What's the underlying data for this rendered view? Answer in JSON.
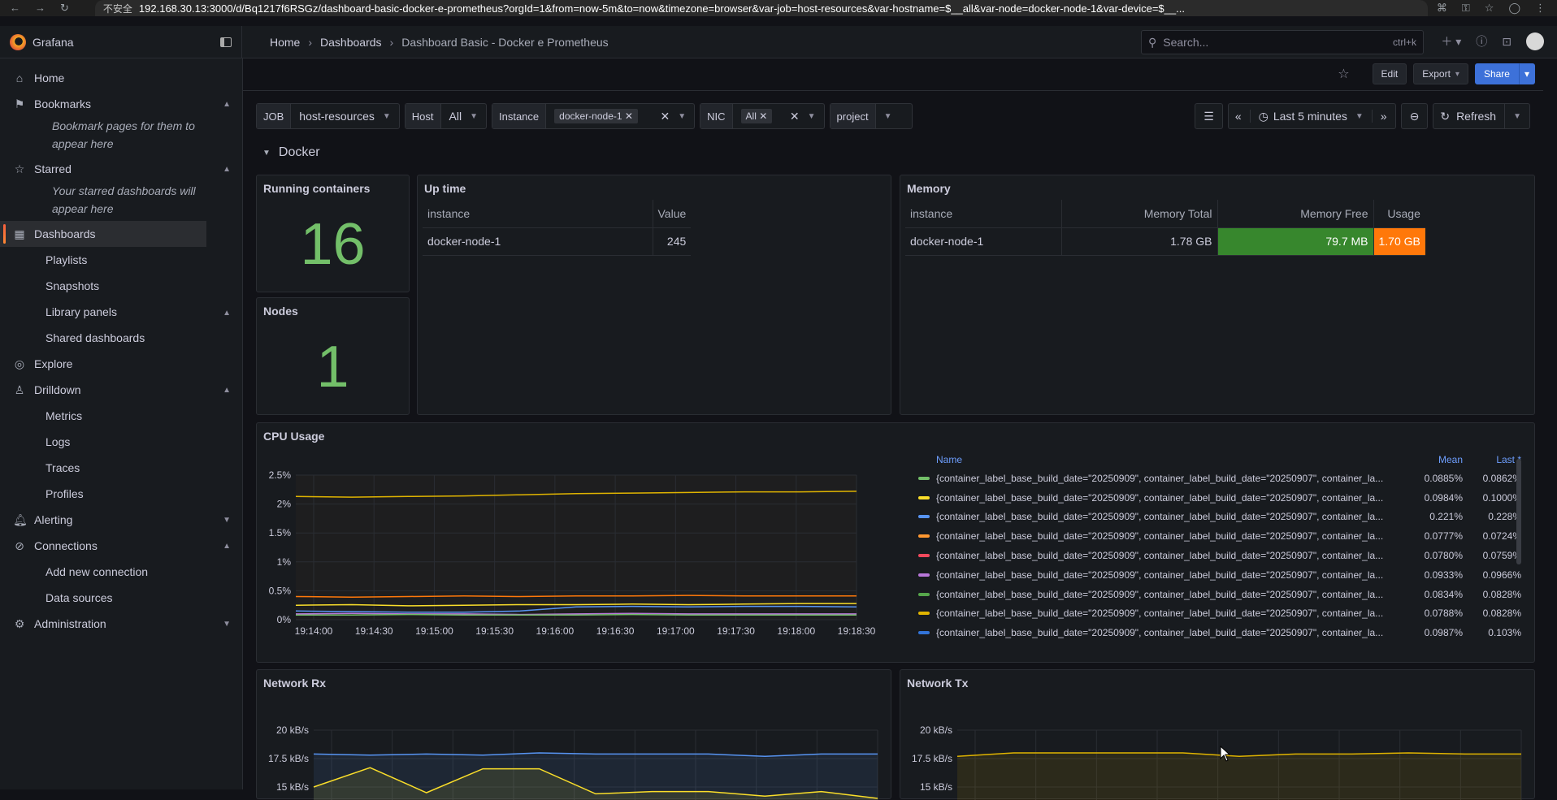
{
  "browser": {
    "insecure": "不安全",
    "url": "192.168.30.13:3000/d/Bq1217f6RSGz/dashboard-basic-docker-e-prometheus?orgId=1&from=now-5m&to=now&timezone=browser&var-job=host-resources&var-hostname=$__all&var-node=docker-node-1&var-device=$__..."
  },
  "app": {
    "name": "Grafana"
  },
  "breadcrumb": [
    "Home",
    "Dashboards",
    "Dashboard Basic - Docker e Prometheus"
  ],
  "search": {
    "placeholder": "Search...",
    "shortcut": "ctrl+k"
  },
  "toolbar": {
    "edit": "Edit",
    "export": "Export",
    "share": "Share"
  },
  "sidebar": {
    "home": "Home",
    "bookmarks": "Bookmarks",
    "bookmarks_hint": "Bookmark pages for them to appear here",
    "starred": "Starred",
    "starred_hint": "Your starred dashboards will appear here",
    "dashboards": "Dashboards",
    "dash_sub": [
      "Playlists",
      "Snapshots",
      "Library panels",
      "Shared dashboards"
    ],
    "explore": "Explore",
    "drilldown": "Drilldown",
    "drill_sub": [
      "Metrics",
      "Logs",
      "Traces",
      "Profiles"
    ],
    "alerting": "Alerting",
    "connections": "Connections",
    "conn_sub": [
      "Add new connection",
      "Data sources"
    ],
    "administration": "Administration"
  },
  "variables": {
    "job_label": "JOB",
    "job_value": "host-resources",
    "host_label": "Host",
    "host_value": "All",
    "instance_label": "Instance",
    "instance_value": "docker-node-1",
    "nic_label": "NIC",
    "nic_value": "All",
    "project_label": "project"
  },
  "time": {
    "range": "Last 5 minutes",
    "refresh": "Refresh"
  },
  "row": {
    "title": "Docker"
  },
  "panels": {
    "running": {
      "title": "Running containers",
      "value": "16"
    },
    "nodes": {
      "title": "Nodes",
      "value": "1"
    },
    "uptime": {
      "title": "Up time",
      "col1": "instance",
      "col2": "Value",
      "instance": "docker-node-1",
      "value": "245"
    },
    "memory": {
      "title": "Memory",
      "col1": "instance",
      "col2": "Memory Total",
      "col3": "Memory Free",
      "col4": "Usage",
      "instance": "docker-node-1",
      "total": "1.78 GB",
      "free": "79.7 MB",
      "usage": "1.70 GB",
      "free_color": "#37872d",
      "usage_color": "#ff780a"
    },
    "cpu": {
      "title": "CPU Usage",
      "legend_name": "Name",
      "legend_mean": "Mean",
      "legend_last": "Last *"
    },
    "netrx": {
      "title": "Network Rx"
    },
    "nettx": {
      "title": "Network Tx"
    }
  },
  "cpu_legend": [
    {
      "name": "{container_label_base_build_date=\"20250909\", container_label_build_date=\"20250907\", container_la...",
      "mean": "0.0885%",
      "last": "0.0862%",
      "color": "#73bf69"
    },
    {
      "name": "{container_label_base_build_date=\"20250909\", container_label_build_date=\"20250907\", container_la...",
      "mean": "0.0984%",
      "last": "0.1000%",
      "color": "#fade2a"
    },
    {
      "name": "{container_label_base_build_date=\"20250909\", container_label_build_date=\"20250907\", container_la...",
      "mean": "0.221%",
      "last": "0.228%",
      "color": "#5794f2"
    },
    {
      "name": "{container_label_base_build_date=\"20250909\", container_label_build_date=\"20250907\", container_la...",
      "mean": "0.0777%",
      "last": "0.0724%",
      "color": "#ff9830"
    },
    {
      "name": "{container_label_base_build_date=\"20250909\", container_label_build_date=\"20250907\", container_la...",
      "mean": "0.0780%",
      "last": "0.0759%",
      "color": "#f2495c"
    },
    {
      "name": "{container_label_base_build_date=\"20250909\", container_label_build_date=\"20250907\", container_la...",
      "mean": "0.0933%",
      "last": "0.0966%",
      "color": "#b877d9"
    },
    {
      "name": "{container_label_base_build_date=\"20250909\", container_label_build_date=\"20250907\", container_la...",
      "mean": "0.0834%",
      "last": "0.0828%",
      "color": "#56a64b"
    },
    {
      "name": "{container_label_base_build_date=\"20250909\", container_label_build_date=\"20250907\", container_la...",
      "mean": "0.0788%",
      "last": "0.0828%",
      "color": "#e0b400"
    },
    {
      "name": "{container_label_base_build_date=\"20250909\", container_label_build_date=\"20250907\", container_la...",
      "mean": "0.0987%",
      "last": "0.103%",
      "color": "#3274d9"
    }
  ],
  "chart_data": [
    {
      "type": "line",
      "title": "CPU Usage",
      "y_ticks": [
        "2.5%",
        "2%",
        "1.5%",
        "1%",
        "0.5%",
        "0%"
      ],
      "x_ticks": [
        "19:14:00",
        "19:14:30",
        "19:15:00",
        "19:15:30",
        "19:16:00",
        "19:16:30",
        "19:17:00",
        "19:17:30",
        "19:18:00",
        "19:18:30"
      ],
      "ylim": [
        0,
        2.5
      ],
      "series": [
        {
          "color": "#e0b400",
          "values": [
            2.13,
            2.12,
            2.13,
            2.14,
            2.16,
            2.18,
            2.19,
            2.2,
            2.21,
            2.21,
            2.22
          ]
        },
        {
          "color": "#ff780a",
          "values": [
            0.4,
            0.39,
            0.4,
            0.41,
            0.4,
            0.41,
            0.41,
            0.42,
            0.41,
            0.41,
            0.41
          ]
        },
        {
          "color": "#fade2a",
          "values": [
            0.25,
            0.26,
            0.24,
            0.25,
            0.26,
            0.26,
            0.27,
            0.26,
            0.27,
            0.28,
            0.28
          ]
        },
        {
          "color": "#5794f2",
          "values": [
            0.15,
            0.14,
            0.13,
            0.13,
            0.15,
            0.22,
            0.23,
            0.22,
            0.23,
            0.23,
            0.22
          ]
        },
        {
          "color": "#b877d9",
          "values": [
            0.1,
            0.11,
            0.1,
            0.1,
            0.09,
            0.1,
            0.11,
            0.1,
            0.1,
            0.1,
            0.1
          ]
        },
        {
          "color": "#73bf69",
          "values": [
            0.08,
            0.08,
            0.09,
            0.08,
            0.08,
            0.08,
            0.09,
            0.08,
            0.08,
            0.08,
            0.08
          ]
        }
      ]
    },
    {
      "type": "line",
      "title": "Network Rx",
      "y_ticks": [
        "20 kB/s",
        "17.5 kB/s",
        "15 kB/s"
      ],
      "ylim": [
        15,
        20
      ],
      "series": [
        {
          "color": "#5794f2",
          "values": [
            17.9,
            17.8,
            17.9,
            17.8,
            18.0,
            17.9,
            17.9,
            17.9,
            17.7,
            17.9,
            17.9
          ]
        },
        {
          "color": "#fade2a",
          "values": [
            15.0,
            16.7,
            14.5,
            16.6,
            16.6,
            14.4,
            14.6,
            14.6,
            14.2,
            14.6,
            14.0
          ]
        }
      ]
    },
    {
      "type": "line",
      "title": "Network Tx",
      "y_ticks": [
        "20 kB/s",
        "17.5 kB/s",
        "15 kB/s"
      ],
      "ylim": [
        15,
        20
      ],
      "series": [
        {
          "color": "#e0b400",
          "values": [
            17.7,
            18.0,
            18.0,
            18.0,
            18.0,
            17.7,
            17.9,
            17.9,
            18.0,
            17.9,
            17.9
          ]
        }
      ]
    }
  ]
}
